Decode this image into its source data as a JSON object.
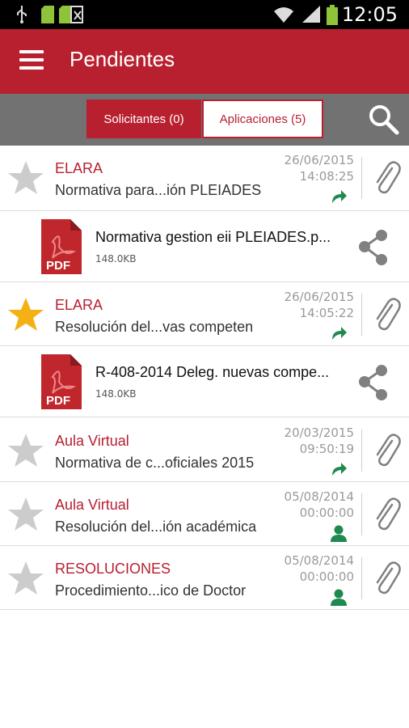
{
  "status_bar": {
    "time": "12:05",
    "icons": [
      "usb-icon",
      "sd-card-icon",
      "sd-card-icon",
      "email-icon",
      "wifi-icon",
      "signal-icon",
      "battery-icon"
    ]
  },
  "app_bar": {
    "title": "Pendientes",
    "menu_icon": "hamburger-menu-icon"
  },
  "tabs": [
    {
      "label": "Solicitantes (0)",
      "selected": false
    },
    {
      "label": "Aplicaciones (5)",
      "selected": true
    }
  ],
  "search_icon": "search-icon",
  "colors": {
    "brand": "#b8202f",
    "tab_bar": "#727272",
    "star_on": "#f5b014",
    "star_off": "#cccccc",
    "status_green": "#1e8a4f",
    "icon_gray": "#808080"
  },
  "rows": [
    {
      "sender": "ELARA",
      "subject": "Normativa para...ión PLEIADES",
      "date": "26/06/2015",
      "time": "14:08:25",
      "starred": false,
      "status_icon": "forward-arrow-icon",
      "attachment": {
        "name": "Normativa gestion eii PLEIADES.p...",
        "size": "148.0KB"
      }
    },
    {
      "sender": "ELARA",
      "subject": "Resolución del...vas competen",
      "date": "26/06/2015",
      "time": "14:05:22",
      "starred": true,
      "status_icon": "forward-arrow-icon",
      "attachment": {
        "name": "R-408-2014 Deleg. nuevas compe...",
        "size": "148.0KB"
      }
    },
    {
      "sender": "Aula Virtual",
      "subject": "Normativa de c...oficiales 2015",
      "date": "20/03/2015",
      "time": "09:50:19",
      "starred": false,
      "status_icon": "forward-arrow-icon"
    },
    {
      "sender": "Aula Virtual",
      "subject": "Resolución del...ión académica",
      "date": "05/08/2014",
      "time": "00:00:00",
      "starred": false,
      "status_icon": "person-icon"
    },
    {
      "sender": "RESOLUCIONES",
      "subject": "Procedimiento...ico de Doctor",
      "date": "05/08/2014",
      "time": "00:00:00",
      "starred": false,
      "status_icon": "person-icon"
    }
  ]
}
